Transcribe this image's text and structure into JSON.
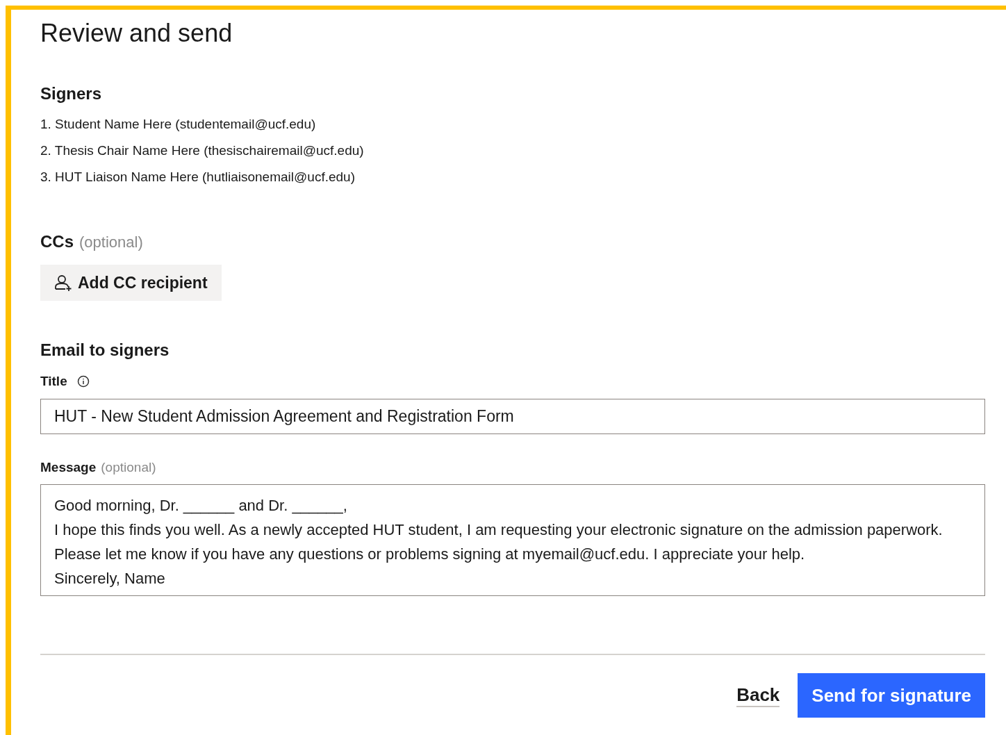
{
  "page": {
    "title": "Review and send"
  },
  "signers": {
    "heading": "Signers",
    "items": [
      {
        "label": "1. Student Name Here (studentemail@ucf.edu)"
      },
      {
        "label": "2. Thesis Chair Name Here (thesischairemail@ucf.edu)"
      },
      {
        "label": "3. HUT Liaison Name Here (hutliaisonemail@ucf.edu)"
      }
    ]
  },
  "ccs": {
    "heading": "CCs",
    "note": "(optional)",
    "button": "Add CC recipient"
  },
  "email": {
    "heading": "Email to signers",
    "title_label": "Title",
    "title_value": "HUT - New Student Admission Agreement and Registration Form",
    "message_label": "Message",
    "message_note": "(optional)",
    "message_value": [
      "Good morning, Dr. ______ and Dr. ______,",
      "I hope this finds you well. As a newly accepted HUT student, I am requesting your electronic signature on the admission paperwork. Please let me know if you have any questions or problems signing at myemail@ucf.edu. I appreciate your help.",
      "Sincerely, Name"
    ]
  },
  "footer": {
    "back": "Back",
    "send": "Send for signature"
  }
}
